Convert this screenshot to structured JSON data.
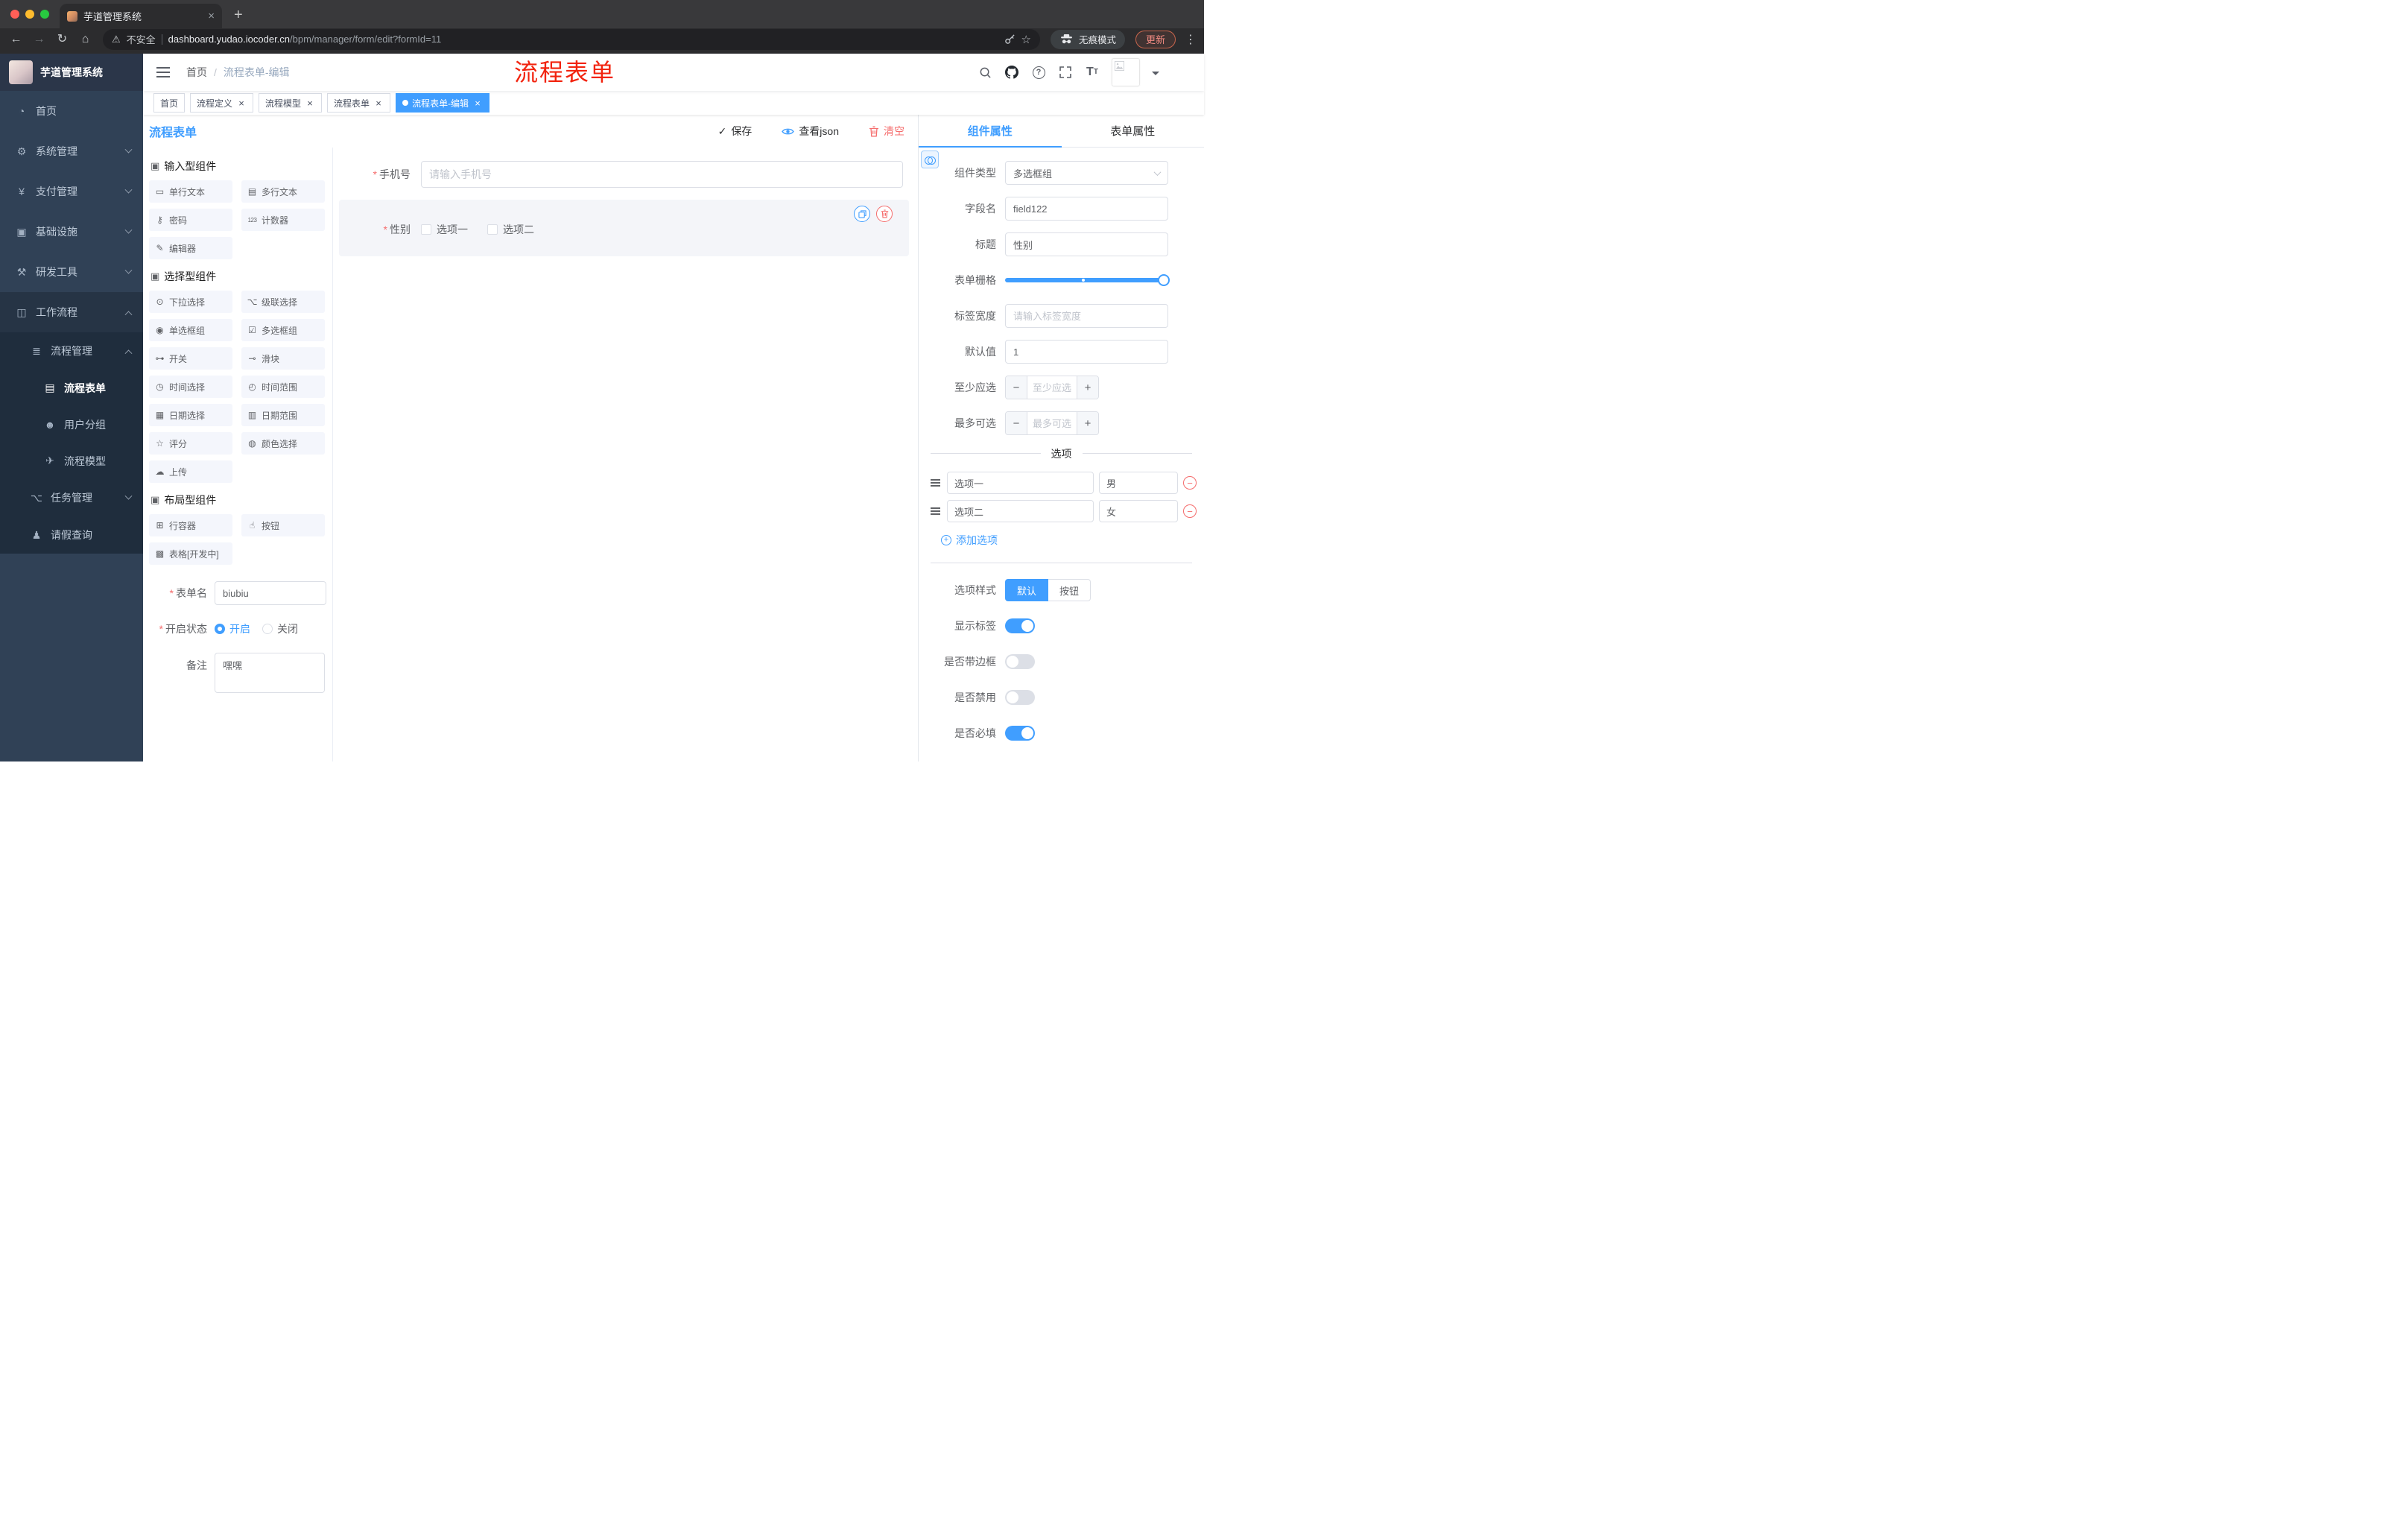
{
  "browser": {
    "tab_title": "芋道管理系统",
    "security_label": "不安全",
    "url_host": "dashboard.yudao.iocoder.cn",
    "url_path": "/bpm/manager/form/edit?formId=11",
    "incognito_label": "无痕模式",
    "update_label": "更新"
  },
  "sidebar": {
    "logo_title": "芋道管理系统",
    "menu": [
      {
        "id": "dashboard",
        "label": "首页",
        "icon": "dashboard-icon",
        "level": 1
      },
      {
        "id": "system",
        "label": "系统管理",
        "icon": "gear-icon",
        "level": 1,
        "arrow": "down"
      },
      {
        "id": "payment",
        "label": "支付管理",
        "icon": "payment-icon",
        "level": 1,
        "arrow": "down"
      },
      {
        "id": "infrastructure",
        "label": "基础设施",
        "icon": "infrastructure-icon",
        "level": 1,
        "arrow": "down"
      },
      {
        "id": "dev-tools",
        "label": "研发工具",
        "icon": "tools-icon",
        "level": 1,
        "arrow": "down"
      },
      {
        "id": "workflow",
        "label": "工作流程",
        "icon": "workflow-icon",
        "level": 1,
        "arrow": "up",
        "open": true
      },
      {
        "id": "process-manage",
        "label": "流程管理",
        "icon": "process-manage-icon",
        "level": 2,
        "arrow": "up",
        "open": true
      },
      {
        "id": "process-form",
        "label": "流程表单",
        "icon": "process-form-icon",
        "level": 3,
        "active": true
      },
      {
        "id": "user-group",
        "label": "用户分组",
        "icon": "user-group-icon",
        "level": 3
      },
      {
        "id": "process-model",
        "label": "流程模型",
        "icon": "process-model-icon",
        "level": 3
      },
      {
        "id": "task-manage",
        "label": "任务管理",
        "icon": "task-manage-icon",
        "level": 2,
        "arrow": "down"
      },
      {
        "id": "leave-query",
        "label": "请假查询",
        "icon": "leave-query-icon",
        "level": 2
      }
    ]
  },
  "navbar": {
    "breadcrumb": [
      "首页",
      "流程表单-编辑"
    ],
    "annotation": "流程表单"
  },
  "tags": [
    {
      "label": "首页",
      "closable": false,
      "active": false
    },
    {
      "label": "流程定义",
      "closable": true,
      "active": false
    },
    {
      "label": "流程模型",
      "closable": true,
      "active": false
    },
    {
      "label": "流程表单",
      "closable": true,
      "active": false
    },
    {
      "label": "流程表单-编辑",
      "closable": true,
      "active": true
    }
  ],
  "designer": {
    "title": "流程表单",
    "actions": {
      "save": "保存",
      "view_json": "查看json",
      "clear": "清空"
    },
    "groups": [
      {
        "title": "输入型组件",
        "items": [
          {
            "label": "单行文本",
            "icon": "single-line-text-icon"
          },
          {
            "label": "多行文本",
            "icon": "multi-line-text-icon"
          },
          {
            "label": "密码",
            "icon": "password-icon"
          },
          {
            "label": "计数器",
            "icon": "counter-icon"
          },
          {
            "label": "编辑器",
            "icon": "editor-icon"
          }
        ]
      },
      {
        "title": "选择型组件",
        "items": [
          {
            "label": "下拉选择",
            "icon": "select-icon"
          },
          {
            "label": "级联选择",
            "icon": "cascader-icon"
          },
          {
            "label": "单选框组",
            "icon": "radio-group-icon"
          },
          {
            "label": "多选框组",
            "icon": "checkbox-group-icon"
          },
          {
            "label": "开关",
            "icon": "switch-icon"
          },
          {
            "label": "滑块",
            "icon": "slider-icon"
          },
          {
            "label": "时间选择",
            "icon": "time-picker-icon"
          },
          {
            "label": "时间范围",
            "icon": "time-range-icon"
          },
          {
            "label": "日期选择",
            "icon": "date-picker-icon"
          },
          {
            "label": "日期范围",
            "icon": "date-range-icon"
          },
          {
            "label": "评分",
            "icon": "rate-icon"
          },
          {
            "label": "颜色选择",
            "icon": "color-picker-icon"
          },
          {
            "label": "上传",
            "icon": "upload-icon"
          }
        ]
      },
      {
        "title": "布局型组件",
        "items": [
          {
            "label": "行容器",
            "icon": "row-container-icon"
          },
          {
            "label": "按钮",
            "icon": "button-icon"
          },
          {
            "label": "表格[开发中]",
            "icon": "table-icon"
          }
        ]
      }
    ],
    "meta": {
      "form_name_label": "表单名",
      "form_name_value": "biubiu",
      "status_label": "开启状态",
      "status_options": [
        {
          "label": "开启",
          "selected": true
        },
        {
          "label": "关闭",
          "selected": false
        }
      ],
      "remark_label": "备注",
      "remark_value": "嘿嘿"
    },
    "canvas": {
      "phone_label": "手机号",
      "phone_placeholder": "请输入手机号",
      "gender_label": "性别",
      "gender_options": [
        "选项一",
        "选项二"
      ]
    }
  },
  "properties": {
    "tabs": [
      {
        "label": "组件属性",
        "active": true
      },
      {
        "label": "表单属性",
        "active": false
      }
    ],
    "component_type_label": "组件类型",
    "component_type_value": "多选框组",
    "field_name_label": "字段名",
    "field_name_value": "field122",
    "title_label": "标题",
    "title_value": "性别",
    "grid_label": "表单栅格",
    "label_width_label": "标签宽度",
    "label_width_placeholder": "请输入标签宽度",
    "default_label": "默认值",
    "default_value": "1",
    "min_label": "至少应选",
    "min_placeholder": "至少应选",
    "max_label": "最多可选",
    "max_placeholder": "最多可选",
    "options_divider": "选项",
    "options": [
      {
        "label": "选项一",
        "value": "男"
      },
      {
        "label": "选项二",
        "value": "女"
      }
    ],
    "add_option_label": "添加选项",
    "option_style_label": "选项样式",
    "option_styles": [
      {
        "label": "默认",
        "active": true
      },
      {
        "label": "按钮",
        "active": false
      }
    ],
    "toggles": [
      {
        "label": "显示标签",
        "on": true
      },
      {
        "label": "是否带边框",
        "on": false
      },
      {
        "label": "是否禁用",
        "on": false
      },
      {
        "label": "是否必填",
        "on": true
      }
    ],
    "accent_color": "#409eff",
    "danger_color": "#f56c6c"
  }
}
